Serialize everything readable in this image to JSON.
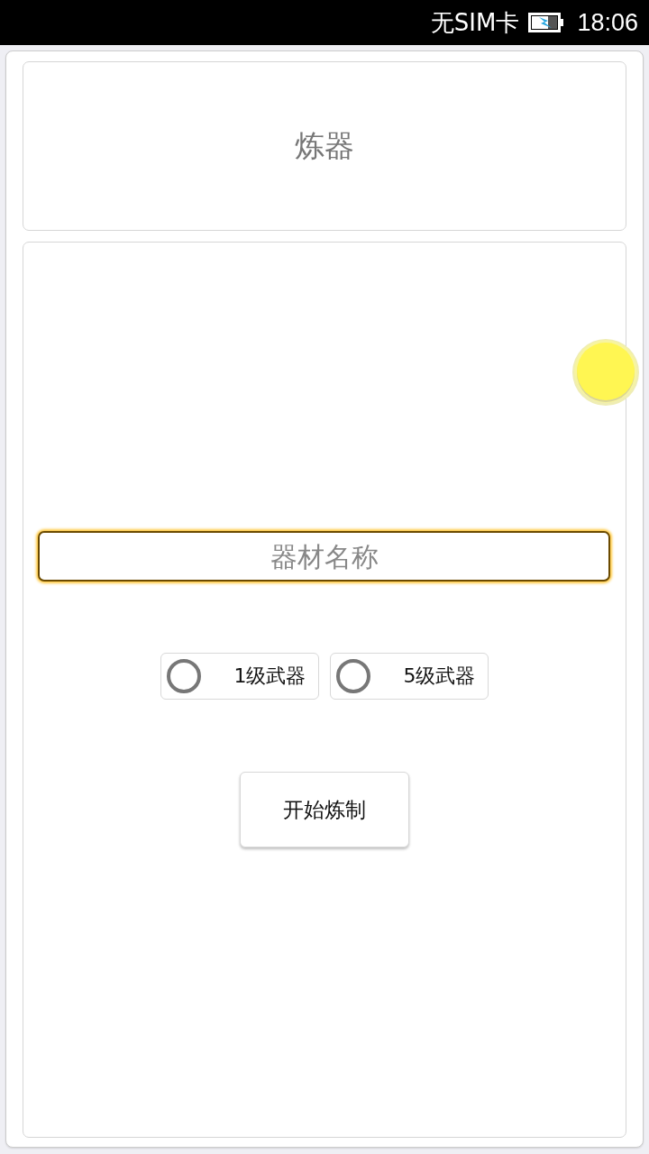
{
  "status_bar": {
    "carrier": "无SIM卡",
    "time": "18:06"
  },
  "header": {
    "title": "炼器"
  },
  "form": {
    "name_field": {
      "placeholder": "器材名称"
    },
    "options": [
      {
        "label": "1级武器",
        "selected": false
      },
      {
        "label": "5级武器",
        "selected": false
      }
    ],
    "button": "开始炼制"
  }
}
